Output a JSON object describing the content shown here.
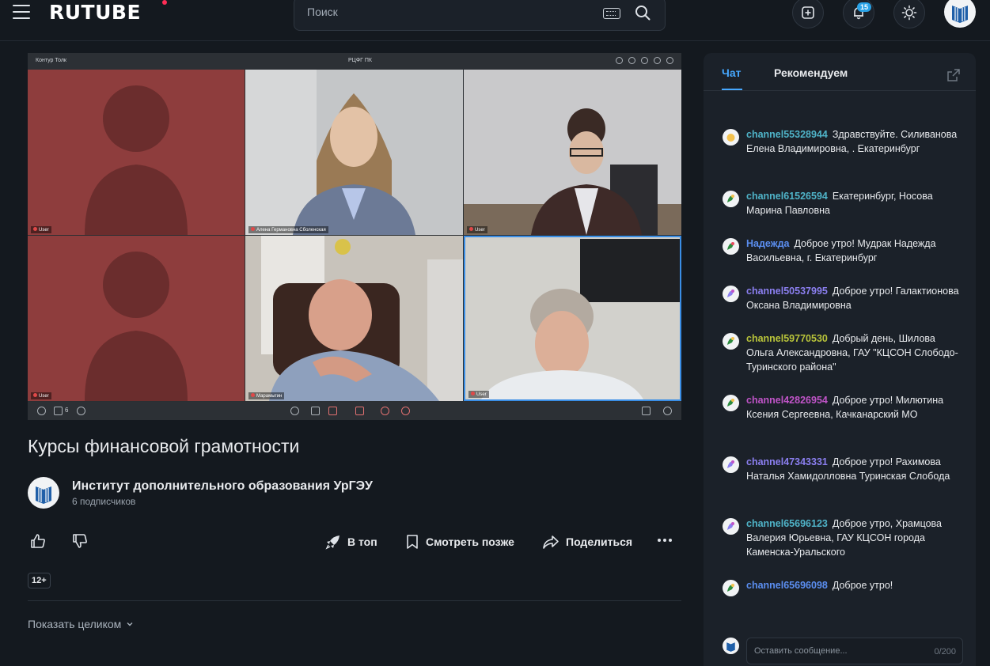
{
  "header": {
    "logo": "RUTUBE",
    "search_placeholder": "Поиск",
    "notifications_count": "15"
  },
  "player": {
    "app_name": "Контур Толк",
    "room_name": "РЦФГ ПК",
    "participants_count": "6",
    "tiles": [
      {
        "label": "User"
      },
      {
        "label": "Алена Германовна Сболенская"
      },
      {
        "label": "User"
      },
      {
        "label": "User"
      },
      {
        "label": "Марамыгин"
      },
      {
        "label": "User"
      }
    ]
  },
  "video": {
    "title": "Курсы финансовой грамотности",
    "channel_name": "Институт дополнительного образования УрГЭУ",
    "subscribers": "6 подписчиков",
    "age_rating": "12+",
    "show_more": "Показать целиком"
  },
  "actions": {
    "top": "В топ",
    "watch_later": "Смотреть позже",
    "share": "Поделиться"
  },
  "chat": {
    "tab_chat": "Чат",
    "tab_recommended": "Рекомендуем",
    "input_placeholder": "Оставить сообщение...",
    "counter": "0/200",
    "messages": [
      {
        "user": "channel55328944",
        "text": "Здравствуйте. Силиванова Елена Владимировна, . Екатеринбург",
        "color": "#4fb3c8"
      },
      {
        "user": "channel61526594",
        "text": "Екатеринбург, Носова Марина Павловна",
        "color": "#4fb3c8"
      },
      {
        "user": "Надежда",
        "text": "Доброе утро! Мудрак Надежда Васильевна, г. Екатеринбург",
        "color": "#5b8ef0"
      },
      {
        "user": "channel50537995",
        "text": "Доброе утро! Галактионова Оксана Владимировна",
        "color": "#8b7ff0"
      },
      {
        "user": "channel59770530",
        "text": "Добрый день, Шилова Ольга Александровна, ГАУ \"КЦСОН Слободо-Туринского района\"",
        "color": "#b9c43a"
      },
      {
        "user": "channel42826954",
        "text": "Доброе утро! Милютина Ксения Сергеевна, Качканарский МО",
        "color": "#c054c8"
      },
      {
        "user": "channel47343331",
        "text": "Доброе утро! Рахимова Наталья Хамидолловна Туринская Слобода",
        "color": "#8b7ff0"
      },
      {
        "user": "channel65696123",
        "text": "Доброе утро, Храмцова Валерия Юрьевна, ГАУ КЦСОН города Каменска-Уральского",
        "color": "#4fb3c8"
      },
      {
        "user": "channel65696098",
        "text": "Доброе утро!",
        "color": "#5b8ef0"
      }
    ]
  }
}
